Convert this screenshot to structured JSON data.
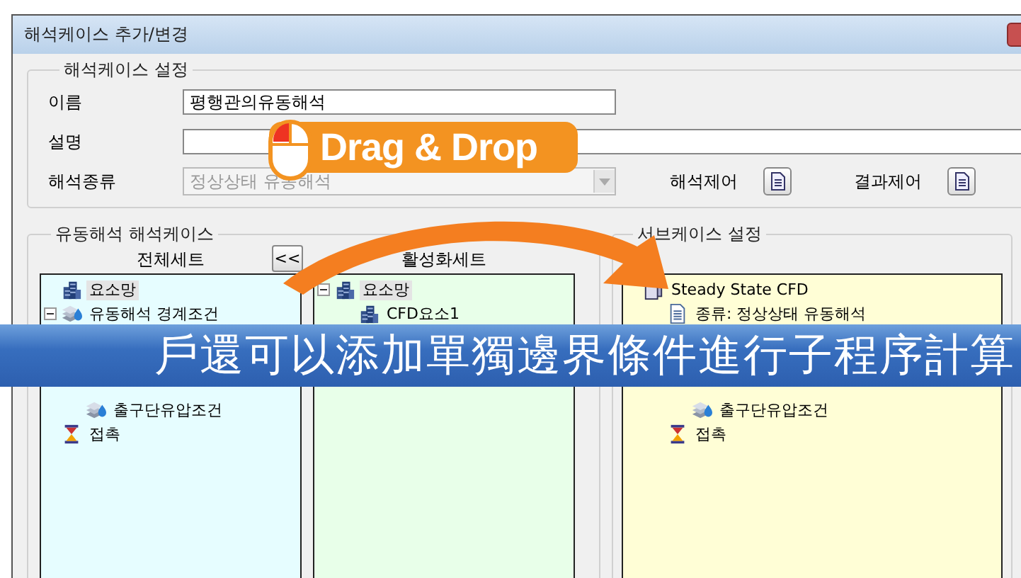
{
  "window": {
    "title": "해석케이스 추가/변경"
  },
  "case_settings": {
    "title": "해석케이스 설정",
    "name_label": "이름",
    "name_value": "평행관의유동해석",
    "description_label": "설명",
    "type_label": "해석종류",
    "type_value": "정상상태 유동해석",
    "type_disabled": true,
    "analysis_control_label": "해석제어",
    "result_control_label": "결과제어"
  },
  "flow_cases": {
    "title": "유동해석 해석케이스",
    "move_button": "<<",
    "full_set": {
      "header": "전체세트",
      "tree": [
        {
          "label": "요소망",
          "kind": "mesh",
          "selected": true
        },
        {
          "label": "유동해석 경계조건",
          "kind": "boundary",
          "selected": false,
          "expanded": true,
          "children": [
            {
              "kind": "covered"
            },
            {
              "kind": "covered"
            },
            {
              "kind": "covered"
            },
            {
              "label": "출구단유압조건",
              "kind": "boundary",
              "selected": false
            }
          ]
        },
        {
          "label": "접촉",
          "kind": "contact",
          "selected": false
        }
      ]
    },
    "active_set": {
      "header": "활성화세트",
      "tree": [
        {
          "label": "요소망",
          "kind": "mesh",
          "selected": true,
          "expanded": true,
          "children": [
            {
              "label": "CFD요소1",
              "kind": "mesh",
              "selected": false
            }
          ]
        }
      ]
    }
  },
  "subcase": {
    "title": "서브케이스 설정",
    "tree": [
      {
        "label": "Steady State CFD",
        "kind": "case",
        "selected": false,
        "children": [
          {
            "label": "종류: 정상상태 유동해석",
            "kind": "doc",
            "selected": false
          },
          {
            "kind": "covered",
            "children": [
              {
                "kind": "covered"
              },
              {
                "kind": "covered"
              },
              {
                "label": "출구단유압조건",
                "kind": "boundary",
                "selected": false
              }
            ]
          },
          {
            "label": "접촉",
            "kind": "contact",
            "selected": false
          }
        ]
      }
    ]
  },
  "overlay": {
    "drag_badge": "Drag & Drop",
    "subtitle": "戶還可以添加單獨邊界條件進行子程序計算"
  }
}
